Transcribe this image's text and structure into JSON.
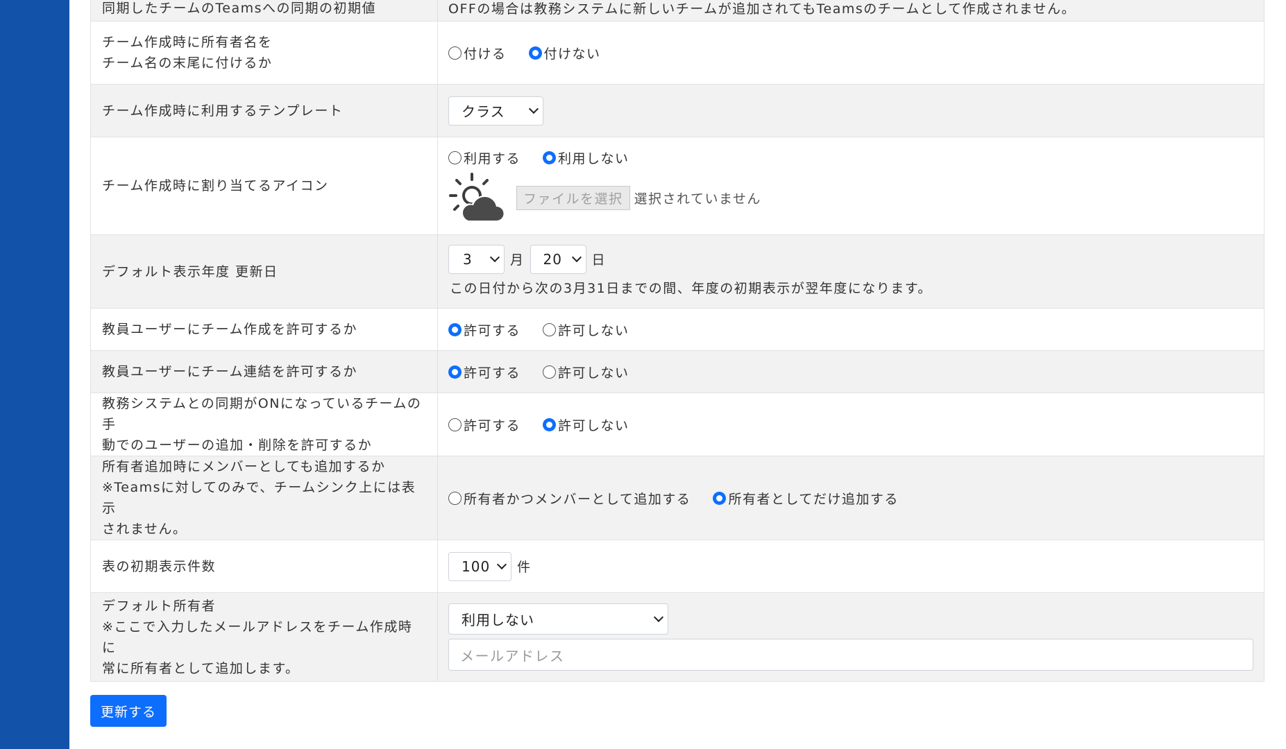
{
  "sidebar": {},
  "settings": {
    "top_partial": {
      "label": "同期したチームのTeamsへの同期の初期値",
      "value": "OFFの場合は教務システムに新しいチームが追加されてもTeamsのチームとして作成されません。"
    },
    "owner_suffix": {
      "label_lines": [
        "チーム作成時に所有者名を",
        "チーム名の末尾に付けるか"
      ],
      "options": [
        "付ける",
        "付けない"
      ],
      "selected": "付けない"
    },
    "template": {
      "label": "チーム作成時に利用するテンプレート",
      "selected": "クラス"
    },
    "team_icon": {
      "label": "チーム作成時に割り当てるアイコン",
      "options": [
        "利用する",
        "利用しない"
      ],
      "selected": "利用しない",
      "icon": "sun-cloud-icon",
      "file_button": "ファイルを選択",
      "file_status": "選択されていません"
    },
    "default_year_update": {
      "label": "デフォルト表示年度 更新日",
      "month": "3",
      "month_unit": "月",
      "day": "20",
      "day_unit": "日",
      "note": "この日付から次の3月31日までの間、年度の初期表示が翌年度になります。"
    },
    "teacher_create": {
      "label": "教員ユーザーにチーム作成を許可するか",
      "options": [
        "許可する",
        "許可しない"
      ],
      "selected": "許可する"
    },
    "teacher_link": {
      "label": "教員ユーザーにチーム連結を許可するか",
      "options": [
        "許可する",
        "許可しない"
      ],
      "selected": "許可する"
    },
    "manual_user_edit": {
      "label_lines": [
        "教務システムとの同期がONになっているチームの手",
        "動でのユーザーの追加・削除を許可するか"
      ],
      "options": [
        "許可する",
        "許可しない"
      ],
      "selected": "許可しない"
    },
    "owner_as_member": {
      "label_lines": [
        "所有者追加時にメンバーとしても追加するか",
        "※Teamsに対してのみで、チームシンク上には表示",
        "されません。"
      ],
      "options": [
        "所有者かつメンバーとして追加する",
        "所有者としてだけ追加する"
      ],
      "selected": "所有者としてだけ追加する"
    },
    "page_size": {
      "label": "表の初期表示件数",
      "selected": "100",
      "unit": "件"
    },
    "default_owner": {
      "label_lines": [
        "デフォルト所有者",
        "※ここで入力したメールアドレスをチーム作成時に",
        "常に所有者として追加します。"
      ],
      "selected": "利用しない",
      "email_placeholder": "メールアドレス"
    }
  },
  "update_button": "更新する",
  "colors": {
    "sidebar": "#1352a9",
    "primary": "#0d6efd",
    "row_alt": "#f2f2f2",
    "border": "#dee2e6"
  }
}
